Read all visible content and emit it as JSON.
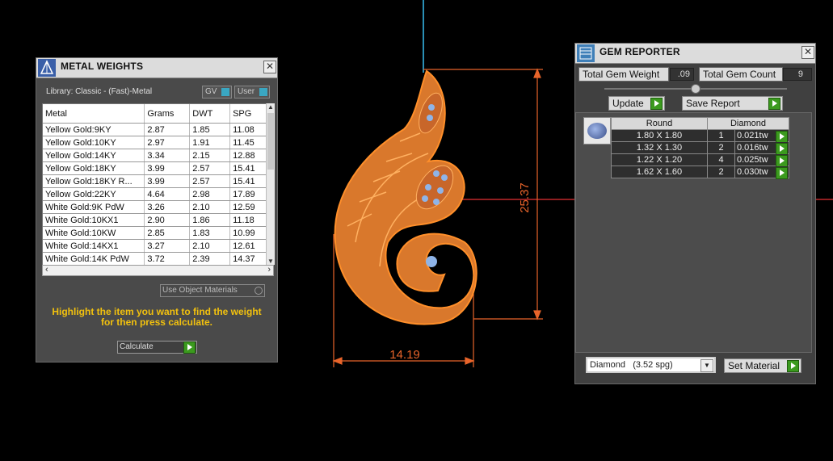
{
  "metal_weights": {
    "title": "METAL WEIGHTS",
    "close": "✕",
    "library": "Library: Classic - (Fast)-Metal",
    "gv_label": "GV",
    "user_label": "User",
    "columns": [
      "Metal",
      "Grams",
      "DWT",
      "SPG"
    ],
    "rows": [
      [
        "Yellow Gold:9KY",
        "2.87",
        "1.85",
        "11.08"
      ],
      [
        "Yellow Gold:10KY",
        "2.97",
        "1.91",
        "11.45"
      ],
      [
        "Yellow Gold:14KY",
        "3.34",
        "2.15",
        "12.88"
      ],
      [
        "Yellow Gold:18KY",
        "3.99",
        "2.57",
        "15.41"
      ],
      [
        "Yellow Gold:18KY R...",
        "3.99",
        "2.57",
        "15.41"
      ],
      [
        "Yellow Gold:22KY",
        "4.64",
        "2.98",
        "17.89"
      ],
      [
        "White Gold:9K PdW",
        "3.26",
        "2.10",
        "12.59"
      ],
      [
        "White Gold:10KX1",
        "2.90",
        "1.86",
        "11.18"
      ],
      [
        "White Gold:10KW",
        "2.85",
        "1.83",
        "10.99"
      ],
      [
        "White Gold:14KX1",
        "3.27",
        "2.10",
        "12.61"
      ],
      [
        "White Gold:14K PdW",
        "3.72",
        "2.39",
        "14.37"
      ]
    ],
    "use_object_materials": "Use Object Materials",
    "instructions": "Highlight the item you want to find the weight for then press calculate.",
    "calculate": "Calculate"
  },
  "viewport": {
    "height_dim": "25.37",
    "width_dim": "14.19",
    "dim_color": "#e8642a",
    "model_color": "#e07b28"
  },
  "gem_reporter": {
    "title": "GEM REPORTER",
    "close": "✕",
    "total_weight_label": "Total Gem Weight",
    "total_weight_value": ".09",
    "total_count_label": "Total Gem Count",
    "total_count_value": "9",
    "update": "Update",
    "save_report": "Save Report",
    "col_shape": "Round",
    "col_material": "Diamond",
    "gems": [
      {
        "size": "1.80 X 1.80",
        "count": "1",
        "weight": "0.021tw"
      },
      {
        "size": "1.32 X 1.30",
        "count": "2",
        "weight": "0.016tw"
      },
      {
        "size": "1.22 X 1.20",
        "count": "4",
        "weight": "0.025tw"
      },
      {
        "size": "1.62 X 1.60",
        "count": "2",
        "weight": "0.030tw"
      }
    ],
    "material_select": "Diamond   (3.52 spg)",
    "set_material": "Set Material"
  }
}
